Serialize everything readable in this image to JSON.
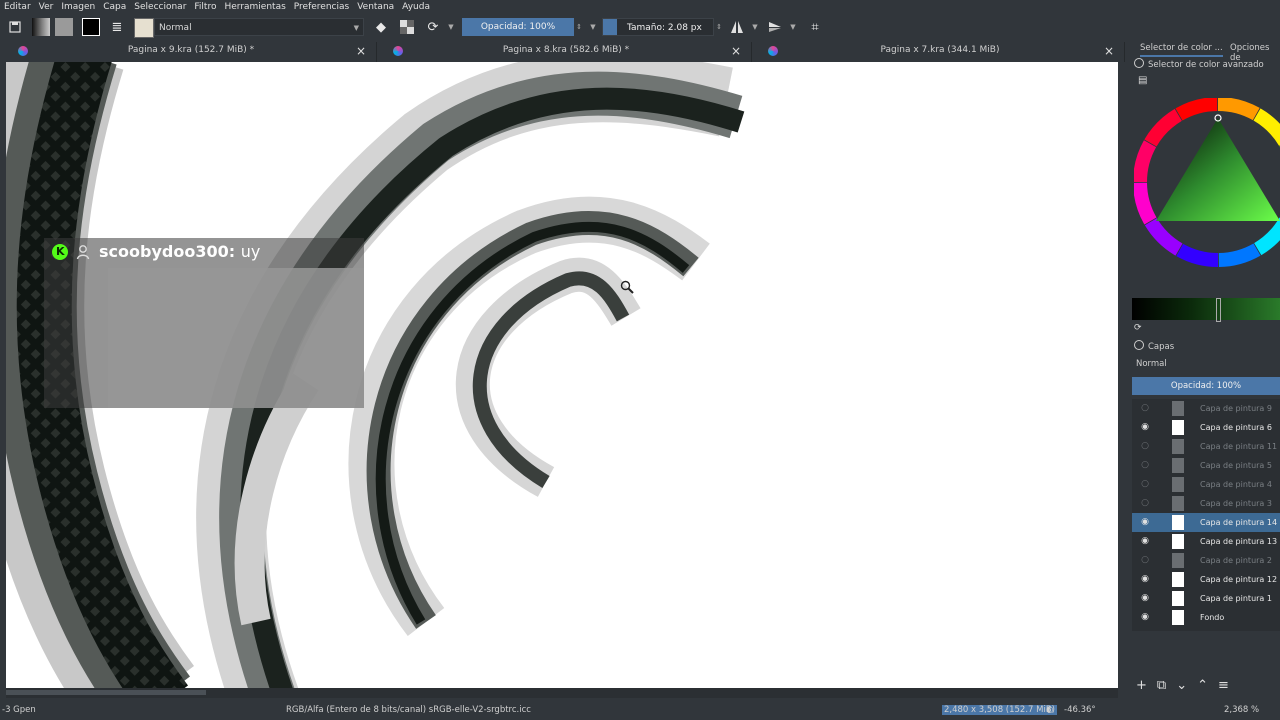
{
  "menu": [
    "Editar",
    "Ver",
    "Imagen",
    "Capa",
    "Seleccionar",
    "Filtro",
    "Herramientas",
    "Preferencias",
    "Ventana",
    "Ayuda"
  ],
  "toolbar": {
    "blend_mode": "Normal",
    "opacity_label": "Opacidad: 100%",
    "size_label": "Tamaño: 2.08 px"
  },
  "tabs": [
    {
      "label": "Pagina x 9.kra (152.7 MiB) *",
      "close": "×"
    },
    {
      "label": "Pagina x 8.kra (582.6 MiB) *",
      "close": "×"
    },
    {
      "label": "Pagina x 7.kra (344.1 MiB)",
      "close": "×"
    }
  ],
  "overlay": {
    "username": "scoobydoo300:",
    "message": "uy"
  },
  "dock": {
    "tab_color": "Selector de color ...",
    "tab_options": "Opciones de",
    "color_selector_title": "Selector de color avanzado",
    "layers_title": "Capas",
    "layers_blend": "Normal",
    "layers_opacity": "Opacidad:  100%",
    "layers": [
      {
        "name": "Capa de pintura 9",
        "visible": false,
        "selected": false
      },
      {
        "name": "Capa de pintura 6",
        "visible": true,
        "selected": false
      },
      {
        "name": "Capa de pintura 11",
        "visible": false,
        "selected": false
      },
      {
        "name": "Capa de pintura 5",
        "visible": false,
        "selected": false
      },
      {
        "name": "Capa de pintura 4",
        "visible": false,
        "selected": false
      },
      {
        "name": "Capa de pintura 3",
        "visible": false,
        "selected": false
      },
      {
        "name": "Capa de pintura 14",
        "visible": true,
        "selected": true
      },
      {
        "name": "Capa de pintura 13",
        "visible": true,
        "selected": false
      },
      {
        "name": "Capa de pintura 2",
        "visible": false,
        "selected": false
      },
      {
        "name": "Capa de pintura 12",
        "visible": true,
        "selected": false
      },
      {
        "name": "Capa de pintura 1",
        "visible": true,
        "selected": false
      },
      {
        "name": "Fondo",
        "visible": true,
        "selected": false
      }
    ]
  },
  "status": {
    "left": "-3 Gpen",
    "colorspace": "RGB/Alfa (Entero de 8 bits/canal)  sRGB-elle-V2-srgbtrc.icc",
    "dimensions": "2,480 x 3,508 (152.7 MiB)",
    "rotation": "-46.36°",
    "zoom": "2,368 %"
  },
  "colors": {
    "accent": "#4b77a8",
    "ui_bg": "#31363b",
    "selected_layer": "#3d6a94"
  }
}
